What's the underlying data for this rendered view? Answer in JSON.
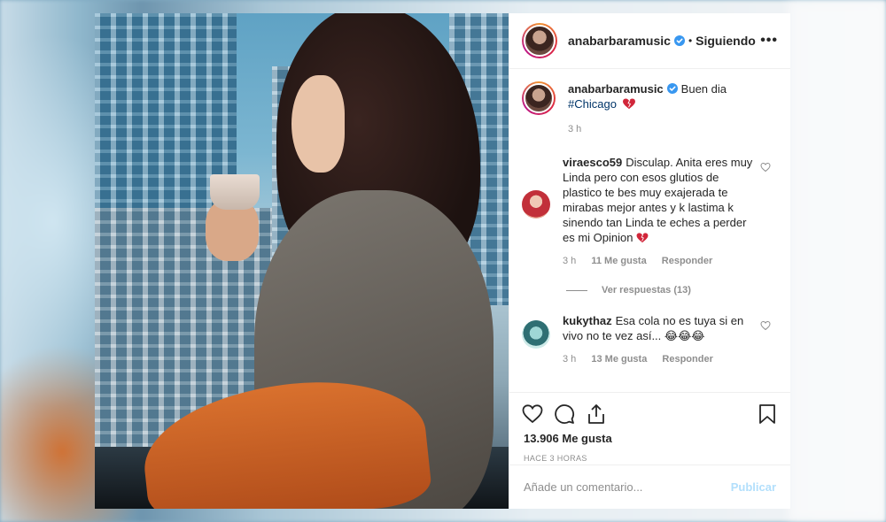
{
  "post": {
    "username": "anabarbaramusic",
    "follow_status": "Siguiendo",
    "caption_text": "Buen dia",
    "hashtag": "#Chicago",
    "caption_time": "3 h",
    "likes": "13.906 Me gusta",
    "posted_ago": "HACE 3 HORAS"
  },
  "comments": [
    {
      "username": "viraesco59",
      "text": "Disculap. Anita eres muy Linda pero con esos glutios de plastico te bes muy exajerada te mirabas mejor antes y k lastima k sinendo tan Linda te eches a perder es mi Opinion",
      "time": "3 h",
      "likes": "11 Me gusta",
      "reply_label": "Responder",
      "view_replies": "Ver respuestas (13)"
    },
    {
      "username": "kukythaz",
      "text": "Esa cola no es tuya si en vivo no te vez así...",
      "emoji": "😂😂😂",
      "time": "3 h",
      "likes": "13 Me gusta",
      "reply_label": "Responder"
    }
  ],
  "comment_box": {
    "placeholder": "Añade un comentario...",
    "publish_label": "Publicar"
  },
  "colors": {
    "verified": "#3897f0",
    "heart": "#ed4956",
    "publish_disabled": "#b2dffc"
  },
  "icons": [
    "heart-icon",
    "comment-icon",
    "share-icon",
    "bookmark-icon",
    "more-options-icon"
  ]
}
